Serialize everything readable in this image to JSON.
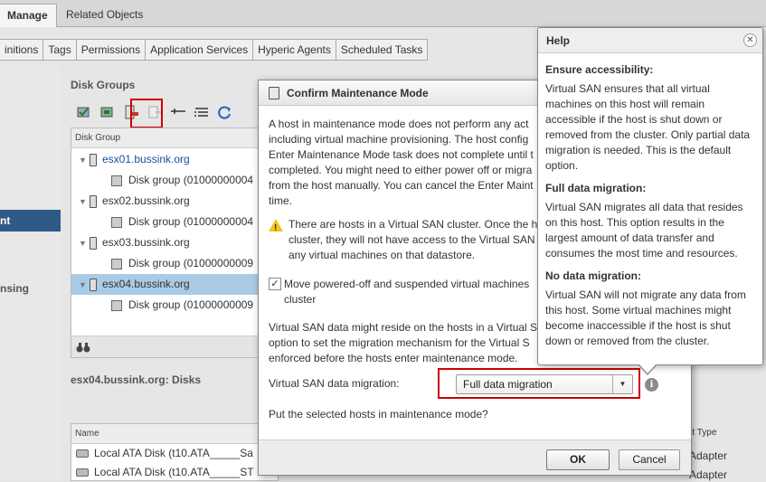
{
  "top_tabs": [
    "Manage",
    "Related Objects"
  ],
  "sub_tabs": [
    "initions",
    "Tags",
    "Permissions",
    "Application Services",
    "Hyperic Agents",
    "Scheduled Tasks"
  ],
  "left_nav": {
    "item1": "nt",
    "item2": "nsing"
  },
  "disk_groups": {
    "title": "Disk Groups",
    "column": "Disk Group",
    "rows": [
      {
        "type": "host",
        "label": "esx01.bussink.org"
      },
      {
        "type": "group",
        "label": "Disk group (01000000004"
      },
      {
        "type": "host",
        "label": "esx02.bussink.org"
      },
      {
        "type": "group",
        "label": "Disk group (01000000004"
      },
      {
        "type": "host",
        "label": "esx03.bussink.org"
      },
      {
        "type": "group",
        "label": "Disk group (01000000009"
      },
      {
        "type": "host",
        "label": "esx04.bussink.org"
      },
      {
        "type": "group",
        "label": "Disk group (01000000009"
      }
    ]
  },
  "disks": {
    "title": "esx04.bussink.org: Disks",
    "column": "Name",
    "rows": [
      "Local ATA Disk (t10.ATA_____Sa",
      "Local ATA Disk (t10.ATA_____ST"
    ],
    "right_column": "rt Type",
    "right_rows": [
      "Adapter",
      "Adapter"
    ]
  },
  "dialog": {
    "title": "Confirm Maintenance Mode",
    "body": [
      "A host in maintenance mode does not perform any act",
      "including virtual machine provisioning. The host config",
      "Enter Maintenance Mode task does not complete until t",
      "completed. You might need to either power off or migra",
      "from the host manually. You can cancel the Enter Maint",
      "time."
    ],
    "warning": [
      "There are hosts in a Virtual SAN cluster. Once the h",
      "cluster, they will not have access to the Virtual SAN",
      "any virtual machines on that datastore."
    ],
    "checkbox_label": [
      "Move powered-off and suspended virtual machines",
      "cluster"
    ],
    "vsan_info": [
      "Virtual SAN data might reside on the hosts in a Virtual S",
      "option to set the migration mechanism for the Virtual S",
      "enforced before the hosts enter maintenance mode."
    ],
    "migration_label": "Virtual SAN data migration:",
    "migration_value": "Full data migration",
    "question": "Put the selected hosts in maintenance mode?",
    "ok": "OK",
    "cancel": "Cancel"
  },
  "help": {
    "title": "Help",
    "sections": [
      {
        "heading": "Ensure accessibility:",
        "text": "Virtual SAN ensures that all virtual machines on this host will remain accessible if the host is shut down or removed from the cluster. Only partial data migration is needed. This is the default option."
      },
      {
        "heading": "Full data migration:",
        "text": "Virtual SAN migrates all data that resides on this host. This option results in the largest amount of data transfer and consumes the most time and resources."
      },
      {
        "heading": "No data migration:",
        "text": "Virtual SAN will not migrate any data from this host. Some virtual machines might become inaccessible if the host is shut down or removed from the cluster."
      }
    ]
  },
  "colors": {
    "selected_nav": "#2f5a87",
    "selected_row": "#a9cbe6",
    "highlight": "#cc0000",
    "link": "#1a4fa0"
  }
}
